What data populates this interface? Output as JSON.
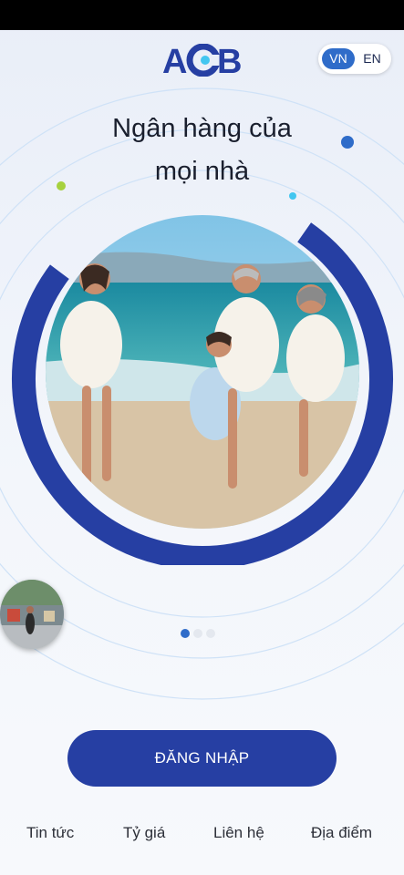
{
  "header": {
    "logo_text": "ACB",
    "language_toggle": {
      "options": [
        "VN",
        "EN"
      ],
      "selected": "VN"
    }
  },
  "hero": {
    "headline_line1": "Ngân hàng của",
    "headline_line2": "mọi nhà"
  },
  "carousel": {
    "slide_count": 3,
    "active_index": 0
  },
  "actions": {
    "login_label": "ĐĂNG NHẬP"
  },
  "bottom_nav": {
    "items": [
      {
        "label": "Tin tức",
        "icon": "news-icon"
      },
      {
        "label": "Tỷ giá",
        "icon": "exchange-rate-icon"
      },
      {
        "label": "Liên hệ",
        "icon": "contact-icon"
      },
      {
        "label": "Địa điểm",
        "icon": "location-icon"
      }
    ]
  },
  "colors": {
    "brand_blue": "#263fa3",
    "accent_blue": "#2f6cc9",
    "accent_green": "#a6d13e",
    "accent_cyan": "#42c6f0"
  }
}
